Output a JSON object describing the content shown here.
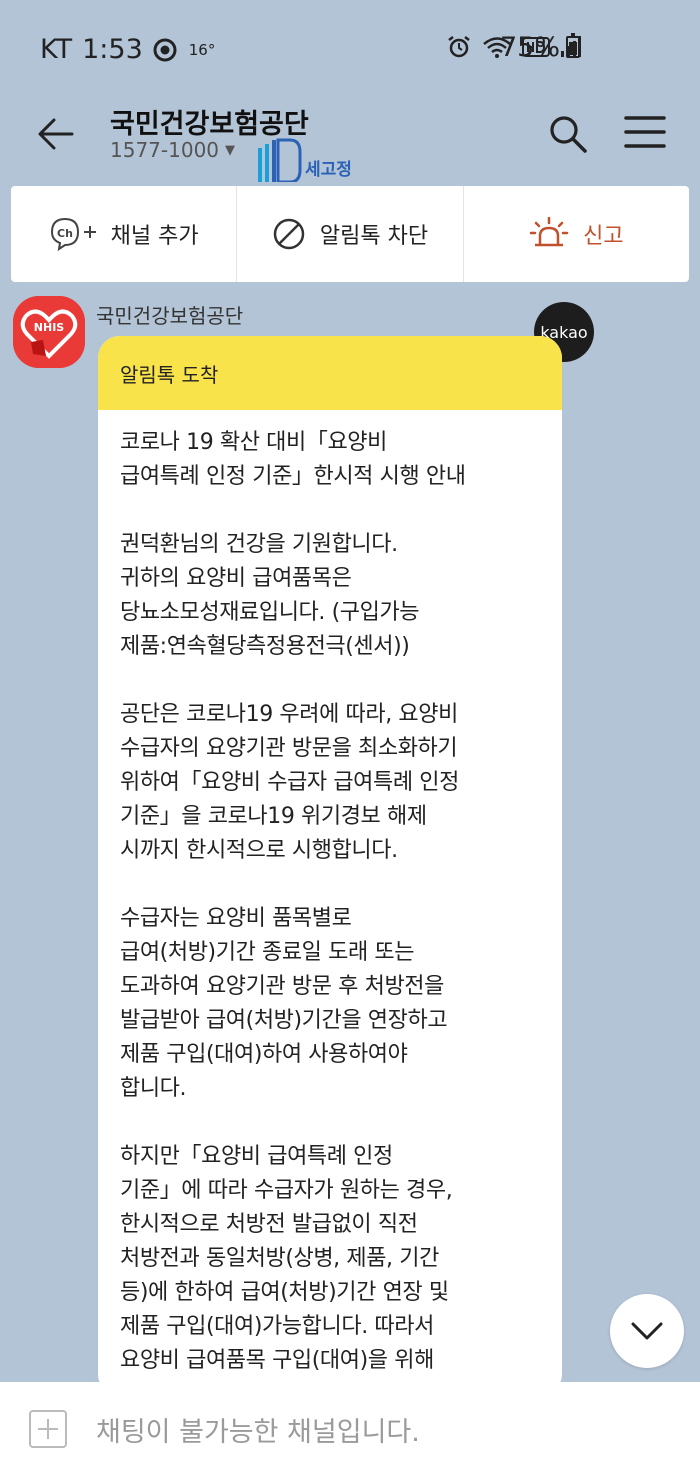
{
  "status_bar": {
    "carrier": "KT",
    "time": "1:53",
    "temperature": "16°",
    "battery": "75%",
    "battery_level": 0.75
  },
  "header": {
    "title": "국민건강보험공단",
    "phone": "1577-1000",
    "watermark_text": "세고정"
  },
  "actions": {
    "add_channel": "채널 추가",
    "block": "알림톡 차단",
    "report": "신고"
  },
  "message": {
    "sender": "국민건강보험공단",
    "avatar_text": "NHIS",
    "badge": "kakao",
    "header": "알림톡 도착",
    "paragraphs": [
      "코로나 19 확산 대비「요양비\n급여특례 인정 기준」한시적 시행 안내",
      "권덕환님의 건강을 기원합니다.\n귀하의 요양비 급여품목은\n당뇨소모성재료입니다. (구입가능\n제품:연속혈당측정용전극(센서))",
      "공단은 코로나19 우려에 따라, 요양비\n수급자의 요양기관 방문을 최소화하기\n위하여「요양비 수급자 급여특례 인정\n기준」을 코로나19 위기경보 해제\n시까지 한시적으로 시행합니다.",
      "수급자는 요양비 품목별로\n급여(처방)기간 종료일 도래 또는\n도과하여 요양기관 방문 후 처방전을\n발급받아 급여(처방)기간을 연장하고\n제품 구입(대여)하여 사용하여야\n합니다.",
      "하지만「요양비 급여특례 인정\n기준」에 따라 수급자가 원하는 경우,\n한시적으로 처방전 발급없이 직전\n처방전과 동일처방(상병, 제품, 기간\n등)에 한하여 급여(처방)기간 연장 및\n제품 구입(대여)가능합니다. 따라서\n요양비 급여품목 구입(대여)을 위해"
    ]
  },
  "input": {
    "placeholder": "채팅이 불가능한 채널입니다."
  },
  "colors": {
    "background": "#b3c4d6",
    "bubble_header": "#f9e34b",
    "report": "#c0512d",
    "avatar": "#ea3a38"
  }
}
